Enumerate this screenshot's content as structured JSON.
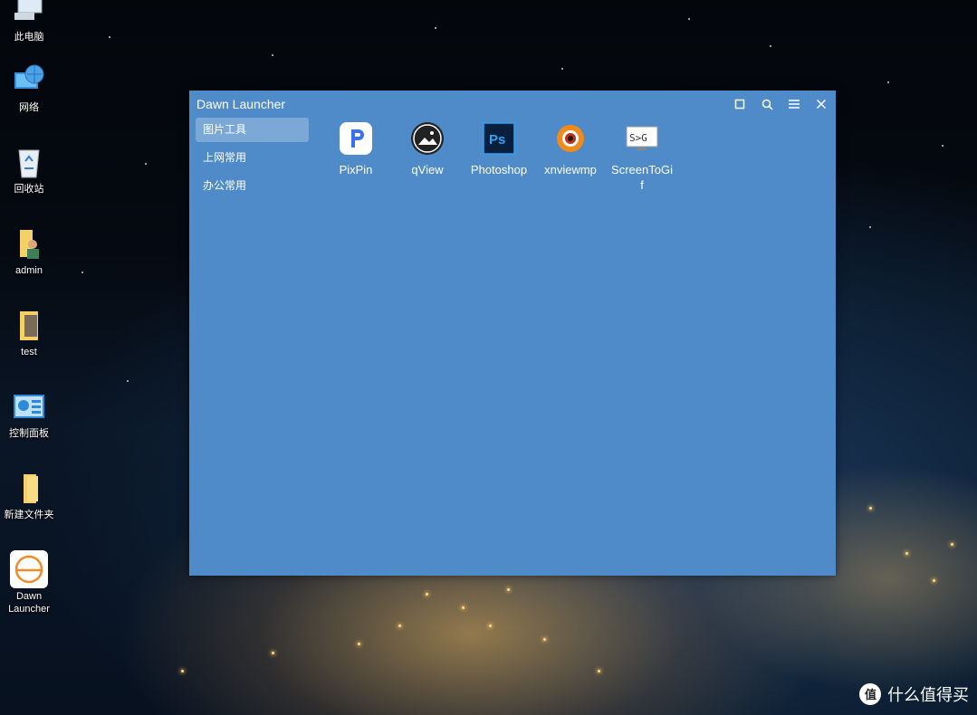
{
  "desktop": {
    "icons": [
      {
        "label": "此电脑",
        "icon": "computer-icon"
      },
      {
        "label": "网络",
        "icon": "network-icon"
      },
      {
        "label": "回收站",
        "icon": "recycle-bin-icon"
      },
      {
        "label": "admin",
        "icon": "user-folder-icon"
      },
      {
        "label": "test",
        "icon": "folder-icon"
      },
      {
        "label": "控制面板",
        "icon": "control-panel-icon"
      },
      {
        "label": "新建文件夹",
        "icon": "folder-icon"
      },
      {
        "label": "Dawn\nLauncher",
        "icon": "dawn-launcher-icon"
      }
    ]
  },
  "window": {
    "title": "Dawn Launcher",
    "controls": [
      "maximize-icon",
      "search-icon",
      "menu-icon",
      "close-icon"
    ],
    "accent": "#4f8bc9",
    "categories": [
      {
        "label": "图片工具",
        "active": true
      },
      {
        "label": "上网常用",
        "active": false
      },
      {
        "label": "办公常用",
        "active": false
      }
    ],
    "apps": [
      {
        "name": "PixPin",
        "icon": "pixpin-icon"
      },
      {
        "name": "qView",
        "icon": "qview-icon"
      },
      {
        "name": "Photoshop",
        "icon": "photoshop-icon"
      },
      {
        "name": "xnviewmp",
        "icon": "xnview-icon"
      },
      {
        "name": "ScreenToGif",
        "icon": "screentogif-icon"
      }
    ]
  },
  "watermark": {
    "text": "什么值得买",
    "icon": "smzdm-icon"
  }
}
